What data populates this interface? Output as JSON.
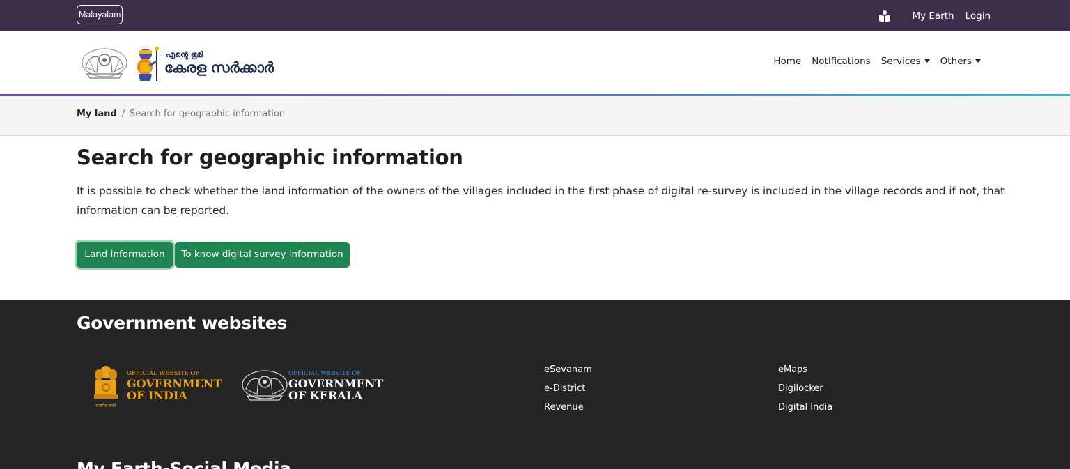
{
  "topbar": {
    "language_button": "Malayalam",
    "icon": "book-reader-icon",
    "my_earth": "My Earth",
    "login": "Login"
  },
  "header": {
    "logo_small": "എന്റെ ഭൂമി",
    "logo_big": "കേരള സർക്കാർ",
    "nav": {
      "home": "Home",
      "notifications": "Notifications",
      "services": "Services",
      "others": "Others"
    }
  },
  "breadcrumb": {
    "home": "My land",
    "separator": "/",
    "current": "Search for geographic information"
  },
  "main": {
    "title": "Search for geographic information",
    "intro": "It is possible to check whether the land information of the owners of the villages included in the first phase of digital re-survey is included in the village records and if not, that information can be reported.",
    "buttons": {
      "land": "Land information",
      "survey": "To know digital survey information"
    }
  },
  "footer": {
    "gov_title": "Government websites",
    "india": {
      "small": "OFFICIAL WEBSITE OF",
      "line1": "GOVERNMENT",
      "line2": "OF INDIA",
      "motto": "सत्यमेव जयते"
    },
    "kerala": {
      "small": "OFFICIAL WEBSITE OF",
      "line1": "GOVERNMENT",
      "line2": "OF KERALA"
    },
    "links_col1": [
      "eSevanam",
      "e-District",
      "Revenue"
    ],
    "links_col2": [
      "eMaps",
      "Digilocker",
      "Digital India"
    ],
    "social_title": "My Earth-Social Media"
  },
  "colors": {
    "topbar": "#3d2f4b",
    "button_green": "#1e8450",
    "footer_bg": "#252525",
    "india_orange": "#e8a318",
    "kerala_blue": "#3d8cd9"
  }
}
